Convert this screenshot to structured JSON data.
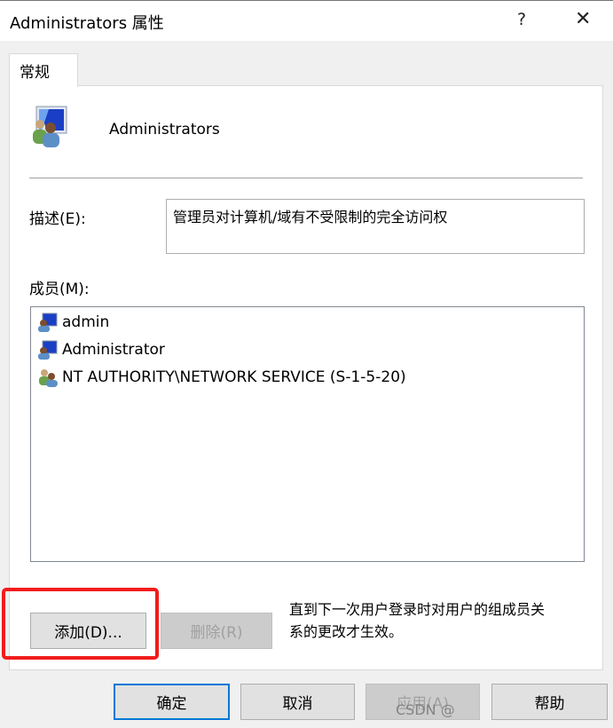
{
  "window": {
    "title": "Administrators 属性",
    "help_label": "?",
    "close_label": "✕"
  },
  "tabs": [
    {
      "label": "常规",
      "active": true
    }
  ],
  "group": {
    "name": "Administrators",
    "icon": "group-users-icon"
  },
  "description": {
    "label": "描述(E):",
    "value": "管理员对计算机/域有不受限制的完全访问权"
  },
  "members": {
    "label": "成员(M):",
    "items": [
      {
        "name": "admin",
        "icon": "user-icon"
      },
      {
        "name": "Administrator",
        "icon": "user-icon"
      },
      {
        "name": "NT AUTHORITY\\NETWORK SERVICE (S-1-5-20)",
        "icon": "group-icon"
      }
    ]
  },
  "buttons": {
    "add": "添加(D)...",
    "remove": "删除(R)",
    "ok": "确定",
    "cancel": "取消",
    "apply": "应用(A)",
    "help": "帮助"
  },
  "note": {
    "line1": "直到下一次用户登录时对用户的组成员关",
    "line2": "系的更改才生效。"
  },
  "watermark": "CSDN @",
  "colors": {
    "highlight": "#f21c1c",
    "default_button_border": "#0078d7"
  }
}
